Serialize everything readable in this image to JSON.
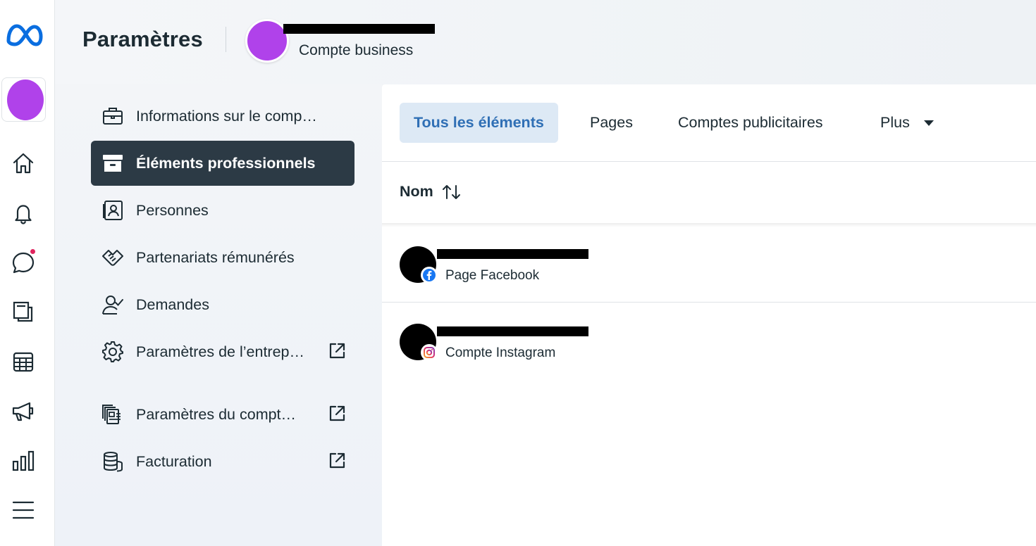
{
  "header": {
    "title": "Paramètres",
    "account_subtitle": "Compte business"
  },
  "rail": {
    "items": [
      {
        "icon": "meta-logo-icon"
      },
      {
        "icon": "account-avatar"
      },
      {
        "icon": "home-icon"
      },
      {
        "icon": "bell-icon"
      },
      {
        "icon": "chat-bubble-icon"
      },
      {
        "icon": "pages-stack-icon"
      },
      {
        "icon": "table-grid-icon"
      },
      {
        "icon": "megaphone-icon"
      },
      {
        "icon": "bar-chart-icon"
      },
      {
        "icon": "menu-icon"
      }
    ],
    "notification_color": "#e0245e"
  },
  "settings_nav": {
    "items": [
      {
        "label": "Informations sur le comp…",
        "icon": "briefcase-icon",
        "external": false
      },
      {
        "label": "Éléments professionnels",
        "icon": "archive-box-icon",
        "external": false,
        "active": true
      },
      {
        "label": "Personnes",
        "icon": "id-card-icon",
        "external": false
      },
      {
        "label": "Partenariats rémunérés",
        "icon": "handshake-icon",
        "external": false
      },
      {
        "label": "Demandes",
        "icon": "user-check-icon",
        "external": false
      },
      {
        "label": "Paramètres de l’entrep…",
        "icon": "gear-icon",
        "external": true
      },
      {
        "label": "Paramètres du compt…",
        "icon": "ad-account-icon",
        "external": true
      },
      {
        "label": "Facturation",
        "icon": "coins-stack-icon",
        "external": true
      }
    ]
  },
  "main": {
    "tabs": [
      {
        "label": "Tous les éléments",
        "active": true
      },
      {
        "label": "Pages"
      },
      {
        "label": "Comptes publicitaires"
      },
      {
        "label": "Plus",
        "dropdown": true
      }
    ],
    "column_header": "Nom",
    "assets": [
      {
        "type_label": "Page Facebook",
        "badge": "facebook-icon"
      },
      {
        "type_label": "Compte Instagram",
        "badge": "instagram-icon"
      }
    ]
  },
  "colors": {
    "accent": "#2f6fb5",
    "active_tab_bg": "#dde9f5",
    "active_nav_bg": "#2c3a45",
    "avatar_purple": "#b042ea",
    "meta_blue": "#0a6ee0"
  }
}
